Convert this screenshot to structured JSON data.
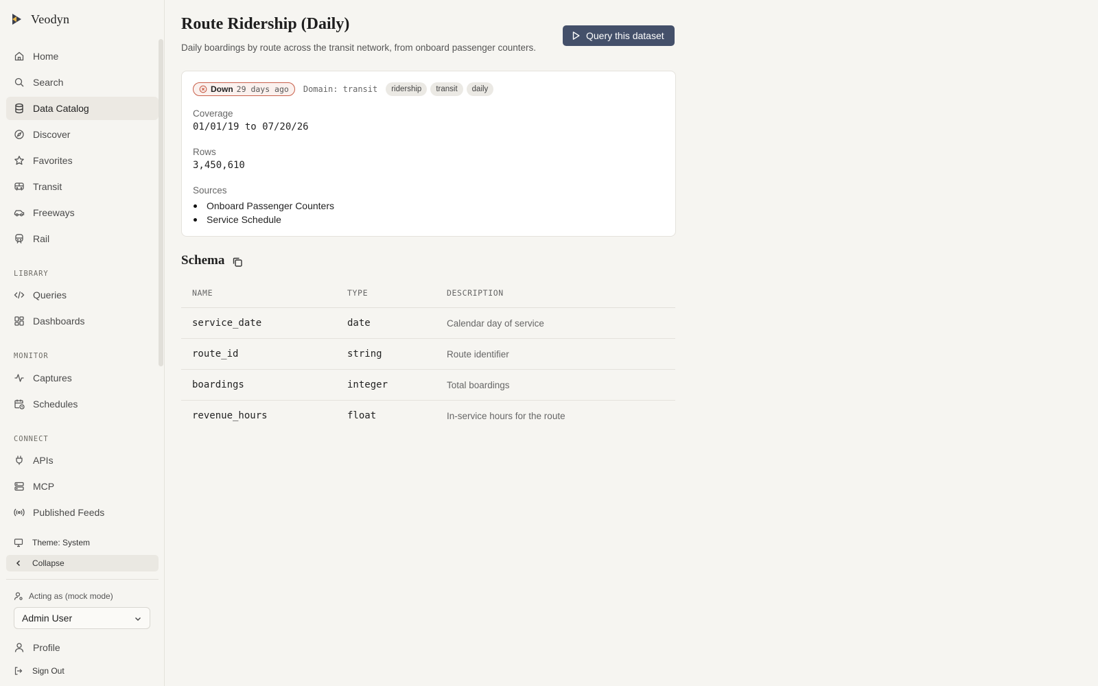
{
  "app": {
    "brand": "Veodyn"
  },
  "sidebar": {
    "nav": [
      {
        "label": "Home",
        "icon": "home-icon"
      },
      {
        "label": "Search",
        "icon": "search-icon"
      },
      {
        "label": "Data Catalog",
        "icon": "database-icon",
        "active": true
      },
      {
        "label": "Discover",
        "icon": "compass-icon"
      },
      {
        "label": "Favorites",
        "icon": "star-icon"
      },
      {
        "label": "Transit",
        "icon": "bus-icon"
      },
      {
        "label": "Freeways",
        "icon": "car-icon"
      },
      {
        "label": "Rail",
        "icon": "train-icon"
      }
    ],
    "library_label": "LIBRARY",
    "library": [
      {
        "label": "Queries",
        "icon": "code-icon"
      },
      {
        "label": "Dashboards",
        "icon": "dashboard-icon"
      }
    ],
    "monitor_label": "MONITOR",
    "monitor": [
      {
        "label": "Captures",
        "icon": "activity-icon"
      },
      {
        "label": "Schedules",
        "icon": "calendar-clock-icon"
      }
    ],
    "connect_label": "CONNECT",
    "connect": [
      {
        "label": "APIs",
        "icon": "plug-icon"
      },
      {
        "label": "MCP",
        "icon": "server-icon"
      },
      {
        "label": "Published Feeds",
        "icon": "broadcast-icon"
      }
    ],
    "theme_label": "Theme: System",
    "collapse_label": "Collapse",
    "acting_label": "Acting as (mock mode)",
    "acting_user": "Admin User",
    "profile_label": "Profile",
    "signout_label": "Sign Out"
  },
  "dataset": {
    "title": "Route Ridership (Daily)",
    "subtitle": "Daily boardings by route across the transit network, from onboard passenger counters.",
    "query_button": "Query this dataset",
    "status": {
      "label": "Down",
      "age": "29 days ago",
      "color": "#c85f4a"
    },
    "domain": "Domain: transit",
    "tags": [
      "ridership",
      "transit",
      "daily"
    ],
    "coverage_label": "Coverage",
    "coverage_value": "01/01/19 to 07/20/26",
    "rows_label": "Rows",
    "rows_value": "3,450,610",
    "sources_label": "Sources",
    "sources": [
      "Onboard Passenger Counters",
      "Service Schedule"
    ]
  },
  "schema": {
    "title": "Schema",
    "columns": [
      "NAME",
      "TYPE",
      "DESCRIPTION"
    ],
    "rows": [
      {
        "name": "service_date",
        "type": "date",
        "description": "Calendar day of service"
      },
      {
        "name": "route_id",
        "type": "string",
        "description": "Route identifier"
      },
      {
        "name": "boardings",
        "type": "integer",
        "description": "Total boardings"
      },
      {
        "name": "revenue_hours",
        "type": "float",
        "description": "In-service hours for the route"
      }
    ]
  },
  "colors": {
    "accent_button": "#44506a",
    "background": "#f6f5f1",
    "status_down": "#c85f4a"
  }
}
